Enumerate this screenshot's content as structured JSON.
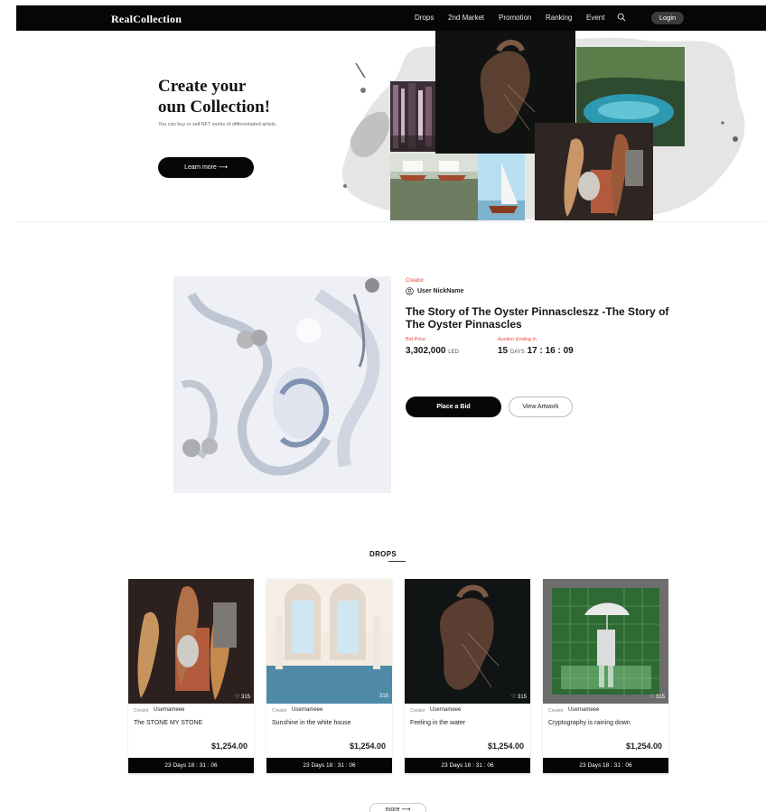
{
  "nav": {
    "logo": "RealCollection",
    "items": [
      "Drops",
      "2nd Market",
      "Promotion",
      "Ranking",
      "Event"
    ],
    "search_icon": "search-icon",
    "login": "Login"
  },
  "hero": {
    "title_line1": "Create your",
    "title_line2": "oun Collection!",
    "subtitle": "You can buy or sell NFT works of differentiated artists.",
    "cta": "Learn more ⟶"
  },
  "featured": {
    "creator_label": "Creator",
    "creator_name": "User NickName",
    "title": "The Story of The Oyster Pinnascleszz -The Story of The Oyster Pinnascles",
    "bid_price_label": "Bid Price",
    "bid_price": "3,302,000",
    "bid_unit": "LED",
    "auction_label": "Auction Ending in",
    "auction_days": "15",
    "auction_days_unit": "DAYS",
    "auction_time": "17 : 16 : 09",
    "place_bid": "Place a Bid",
    "view_artwork": "View Artwork"
  },
  "drops": {
    "title": "DROPS",
    "cards": [
      {
        "creator_label": "Creator",
        "user": "Usernameee",
        "title": "The STONE MY STONE",
        "price": "$1,254.00",
        "timer": "23 Days 18 : 31 : 06",
        "likes": "♡ 315"
      },
      {
        "creator_label": "Creator",
        "user": "Usernameee",
        "title": "Sunshine in the white house",
        "price": "$1,254.00",
        "timer": "23 Days 18 : 31 : 06",
        "likes": "315"
      },
      {
        "creator_label": "Creator",
        "user": "Usernameee",
        "title": "Feeling in the water",
        "price": "$1,254.00",
        "timer": "23 Days 18 : 31 : 06",
        "likes": "♡ 315"
      },
      {
        "creator_label": "Creator",
        "user": "Usernameee",
        "title": "Cryptography is raining down",
        "price": "$1,254.00",
        "timer": "23 Days 18 : 31 : 06",
        "likes": "♡ 315"
      }
    ],
    "more": "more ⟶"
  }
}
